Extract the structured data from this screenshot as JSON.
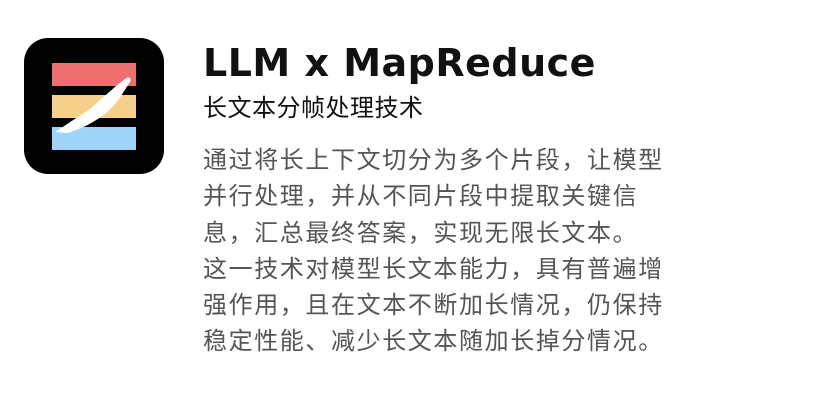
{
  "app": {
    "icon": "stacked-stripes-knife-icon",
    "colors": {
      "background": "#000000",
      "stripe_top": "#EE6F6F",
      "stripe_middle": "#F6CF8A",
      "stripe_bottom": "#9ED4F7",
      "blade": "#FFFFFF"
    }
  },
  "header": {
    "title": "LLM x MapReduce",
    "subtitle": "长文本分帧处理技术"
  },
  "description": {
    "lines": [
      "通过将长上下文切分为多个片段，让模型",
      "并行处理，并从不同片段中提取关键信",
      "息，汇总最终答案，实现无限长文本。",
      "这一技术对模型长文本能力，具有普遍增",
      "强作用，且在文本不断加长情况，仍保持",
      "稳定性能、减少长文本随加长掉分情况。"
    ]
  }
}
